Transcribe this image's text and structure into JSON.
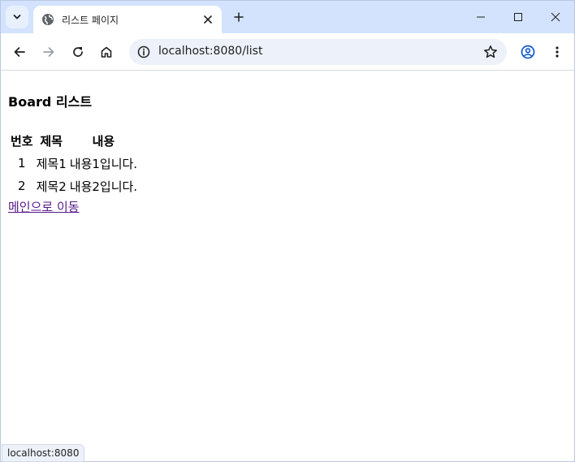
{
  "browser": {
    "tab": {
      "title": "리스트 페이지"
    },
    "address_bar": {
      "url": "localhost:8080/list"
    },
    "status_bubble": "localhost:8080"
  },
  "page": {
    "heading": "Board 리스트",
    "table": {
      "headers": [
        "번호",
        "제목",
        "내용"
      ],
      "rows": [
        [
          "1",
          "제목1",
          "내용1입니다."
        ],
        [
          "2",
          "제목2",
          "내용2입니다."
        ]
      ]
    },
    "link_label": "메인으로 이동"
  },
  "colors": {
    "tabstrip_bg": "#d3e3fd",
    "omnibox_bg": "#edf2fa",
    "visited_link": "#551a8b"
  }
}
